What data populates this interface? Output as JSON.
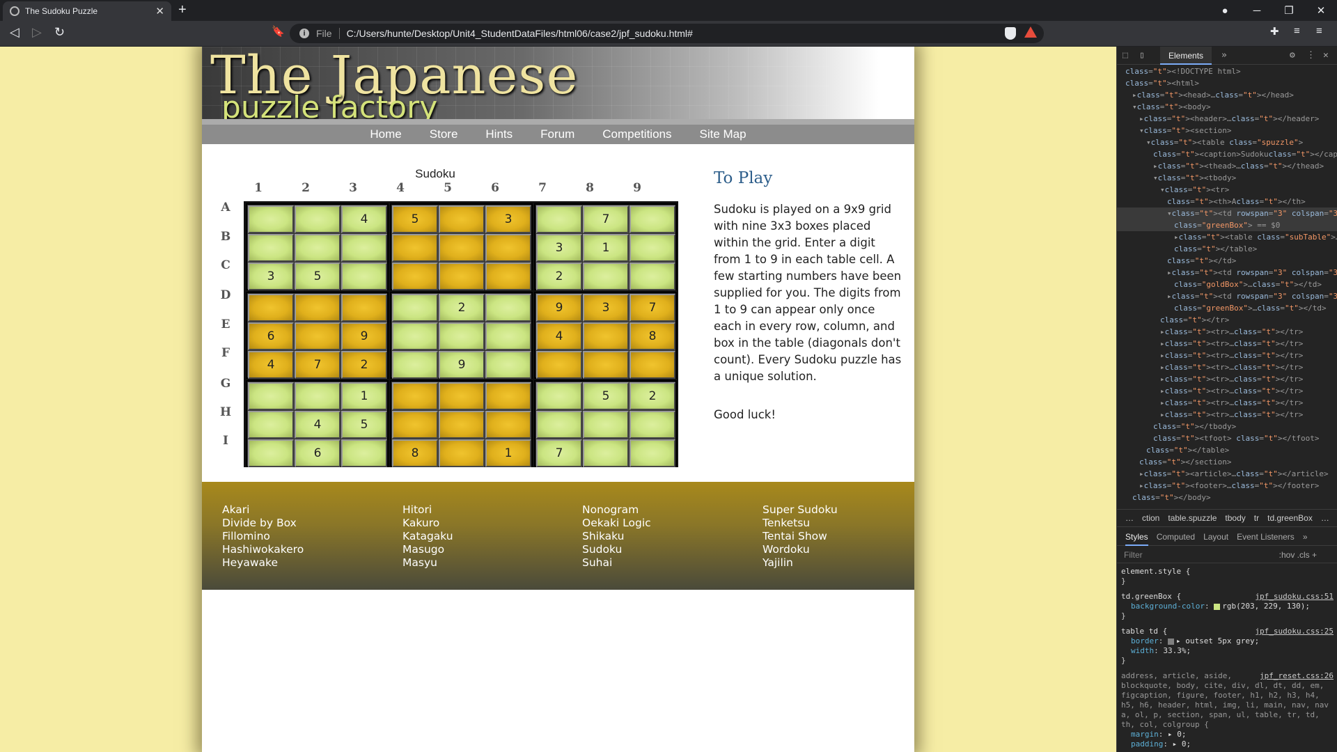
{
  "browser": {
    "tab_title": "The Sudoku Puzzle",
    "address_scheme": "File",
    "address_url": "C:/Users/hunte/Desktop/Unit4_StudentDataFiles/html06/case2/jpf_sudoku.html#"
  },
  "page": {
    "banner_title": "The Japanese",
    "banner_subtitle": "puzzle factory",
    "nav": [
      "Home",
      "Store",
      "Hints",
      "Forum",
      "Competitions",
      "Site Map"
    ],
    "sudoku": {
      "caption": "Sudoku",
      "columns": [
        "1",
        "2",
        "3",
        "4",
        "5",
        "6",
        "7",
        "8",
        "9"
      ],
      "rows": [
        "A",
        "B",
        "C",
        "D",
        "E",
        "F",
        "G",
        "H",
        "I"
      ],
      "box_colors": [
        [
          "g",
          "y",
          "g"
        ],
        [
          "y",
          "g",
          "y"
        ],
        [
          "g",
          "y",
          "g"
        ]
      ],
      "colors": {
        "green": "#cbe582",
        "gold": "#e0b01c"
      },
      "grid": [
        [
          "",
          "",
          "4",
          "5",
          "",
          "3",
          "",
          "7",
          ""
        ],
        [
          "",
          "",
          "",
          "",
          "",
          "",
          "3",
          "1",
          ""
        ],
        [
          "3",
          "5",
          "",
          "",
          "",
          "",
          "2",
          "",
          ""
        ],
        [
          "",
          "",
          "",
          "",
          "2",
          "",
          "9",
          "3",
          "7"
        ],
        [
          "6",
          "",
          "9",
          "",
          "",
          "",
          "4",
          "",
          "8"
        ],
        [
          "4",
          "7",
          "2",
          "",
          "9",
          "",
          "",
          "",
          ""
        ],
        [
          "",
          "",
          "1",
          "",
          "",
          "",
          "",
          "5",
          "2"
        ],
        [
          "",
          "4",
          "5",
          "",
          "",
          "",
          "",
          "",
          ""
        ],
        [
          "",
          "6",
          "",
          "8",
          "",
          "1",
          "7",
          "",
          ""
        ]
      ]
    },
    "article": {
      "title": "To Play",
      "body": "Sudoku is played on a 9x9 grid with nine 3x3 boxes placed within the grid. Enter a digit from 1 to 9 in each table cell. A few starting numbers have been supplied for you. The digits from 1 to 9 can appear only once each in every row, column, and box in the table (diagonals don't count). Every Sudoku puzzle has a unique solution.",
      "closing": "Good luck!"
    },
    "footer_links": [
      [
        "Akari",
        "Divide by Box",
        "Fillomino",
        "Hashiwokakero",
        "Heyawake"
      ],
      [
        "Hitori",
        "Kakuro",
        "Katagaku",
        "Masugo",
        "Masyu"
      ],
      [
        "Nonogram",
        "Oekaki Logic",
        "Shikaku",
        "Sudoku",
        "Suhai"
      ],
      [
        "Super Sudoku",
        "Tenketsu",
        "Tentai Show",
        "Wordoku",
        "Yajilin"
      ]
    ]
  },
  "devtools": {
    "active_tab": "Elements",
    "tree": [
      {
        "i": 0,
        "h": "<!DOCTYPE html>"
      },
      {
        "i": 0,
        "h": "<html>"
      },
      {
        "i": 1,
        "h": "▸<head>…</head>"
      },
      {
        "i": 1,
        "h": "▾<body>"
      },
      {
        "i": 2,
        "h": "▸<header>…</header>"
      },
      {
        "i": 2,
        "h": "▾<section>"
      },
      {
        "i": 3,
        "h": "▾<table class=\"spuzzle\">"
      },
      {
        "i": 4,
        "h": "<caption>Sudoku</caption>"
      },
      {
        "i": 4,
        "h": "▸<thead>…</thead>"
      },
      {
        "i": 4,
        "h": "▾<tbody>"
      },
      {
        "i": 5,
        "h": "▾<tr>"
      },
      {
        "i": 6,
        "h": "<th>A</th>"
      },
      {
        "i": 6,
        "h": "▾<td rowspan=\"3\" colspan=\"3\"",
        "hl": true
      },
      {
        "i": 7,
        "h": "class=\"greenBox\"> == $0",
        "hl": true
      },
      {
        "i": 7,
        "h": "▸<table class=\"subTable\">…"
      },
      {
        "i": 7,
        "h": "</table>"
      },
      {
        "i": 6,
        "h": "</td>"
      },
      {
        "i": 6,
        "h": "▸<td rowspan=\"3\" colspan=\"3\""
      },
      {
        "i": 7,
        "h": "class=\"goldBox\">…</td>"
      },
      {
        "i": 6,
        "h": "▸<td rowspan=\"3\" colspan=\"3\""
      },
      {
        "i": 7,
        "h": "class=\"greenBox\">…</td>"
      },
      {
        "i": 5,
        "h": "</tr>"
      },
      {
        "i": 5,
        "h": "▸<tr>…</tr>"
      },
      {
        "i": 5,
        "h": "▸<tr>…</tr>"
      },
      {
        "i": 5,
        "h": "▸<tr>…</tr>"
      },
      {
        "i": 5,
        "h": "▸<tr>…</tr>"
      },
      {
        "i": 5,
        "h": "▸<tr>…</tr>"
      },
      {
        "i": 5,
        "h": "▸<tr>…</tr>"
      },
      {
        "i": 5,
        "h": "▸<tr>…</tr>"
      },
      {
        "i": 5,
        "h": "▸<tr>…</tr>"
      },
      {
        "i": 4,
        "h": "</tbody>"
      },
      {
        "i": 4,
        "h": "<tfoot> </tfoot>"
      },
      {
        "i": 3,
        "h": "</table>"
      },
      {
        "i": 2,
        "h": "</section>"
      },
      {
        "i": 2,
        "h": "▸<article>…</article>"
      },
      {
        "i": 2,
        "h": "▸<footer>…</footer>"
      },
      {
        "i": 1,
        "h": "</body>"
      }
    ],
    "breadcrumbs": [
      "…",
      "ction",
      "table.spuzzle",
      "tbody",
      "tr",
      "td.greenBox",
      "…"
    ],
    "style_tabs": [
      "Styles",
      "Computed",
      "Layout",
      "Event Listeners",
      "»"
    ],
    "filter_placeholder": "Filter",
    "filter_tools": ":hov  .cls  +",
    "rules": [
      {
        "sel": "element.style {",
        "src": "",
        "props": [],
        "close": "}"
      },
      {
        "sel": "td.greenBox {",
        "src": "jpf_sudoku.css:51",
        "props": [
          [
            "background-color",
            "rgb(203, 229, 130);",
            "#cbe582"
          ]
        ],
        "close": "}"
      },
      {
        "sel": "table td {",
        "src": "jpf_sudoku.css:25",
        "props": [
          [
            "border",
            "▸ outset 5px grey;",
            "#808080"
          ],
          [
            "width",
            "33.3%;",
            ""
          ]
        ],
        "close": "}"
      }
    ],
    "reset_src": "jpf_reset.css:26",
    "reset_selectors": "address, article, aside, blockquote, body, cite, div, dl, dt, dd, em, figcaption, figure, footer, h1, h2, h3, h4, h5, h6, header, html, img, li, main, nav, nav a, ol, p, section, span, ul, table, tr, td, th, col, colgroup {",
    "reset_props": [
      [
        "margin",
        "▸ 0;"
      ],
      [
        "padding",
        "▸ 0;"
      ]
    ]
  }
}
